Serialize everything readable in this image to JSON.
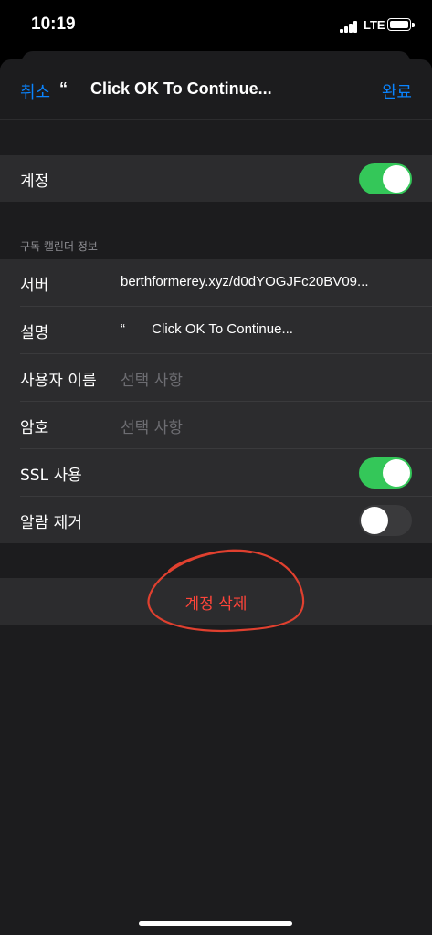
{
  "status": {
    "time": "10:19",
    "network": "LTE"
  },
  "nav": {
    "cancel_label": "취소",
    "title": "“     Click OK To Continue...",
    "done_label": "완료"
  },
  "account": {
    "label": "계정",
    "enabled": true
  },
  "subscription_section": {
    "header": "구독 캘린더 정보",
    "server": {
      "label": "서버",
      "value": "berthformerey.xyz/d0dYOGJFc20BV09..."
    },
    "description": {
      "label": "설명",
      "value": "“       Click OK To Continue..."
    },
    "username": {
      "label": "사용자 이름",
      "placeholder": "선택 사항"
    },
    "password": {
      "label": "암호",
      "placeholder": "선택 사항"
    },
    "ssl": {
      "label": "SSL 사용",
      "enabled": true
    },
    "remove_alarms": {
      "label": "알람 제거",
      "enabled": false
    }
  },
  "delete_account_label": "계정 삭제",
  "colors": {
    "accent": "#0a84ff",
    "toggle_on": "#34c759",
    "destructive": "#ff453a",
    "annotation": "#e0402f"
  }
}
